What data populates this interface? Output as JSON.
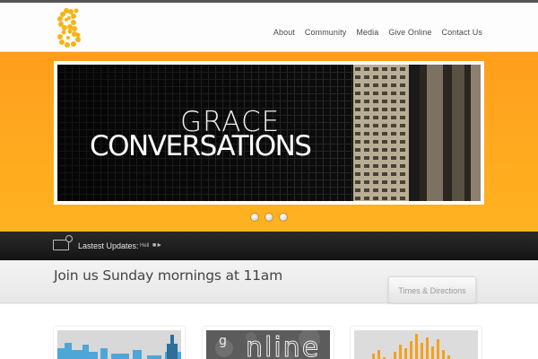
{
  "header": {
    "logo_icon": "grace-g-logo",
    "nav": [
      "About",
      "Community",
      "Media",
      "Give Online",
      "Contact Us"
    ]
  },
  "banner": {
    "title_line1": "GRACE",
    "title_line2": "CONVERSATIONS",
    "slide_count": 3,
    "accent_color": "#ffa81f"
  },
  "updates": {
    "label": "Lastest Updates:",
    "text": "Hell",
    "icon": "monitor-icon"
  },
  "join": {
    "text": "Join us Sunday mornings at 11am",
    "button_label": "Times & Directions"
  },
  "thumbnails": [
    {
      "name": "city-skyline-thumbnail"
    },
    {
      "name": "online-thumbnail",
      "text": "g",
      "text2": "nline"
    },
    {
      "name": "audio-bars-thumbnail"
    }
  ]
}
